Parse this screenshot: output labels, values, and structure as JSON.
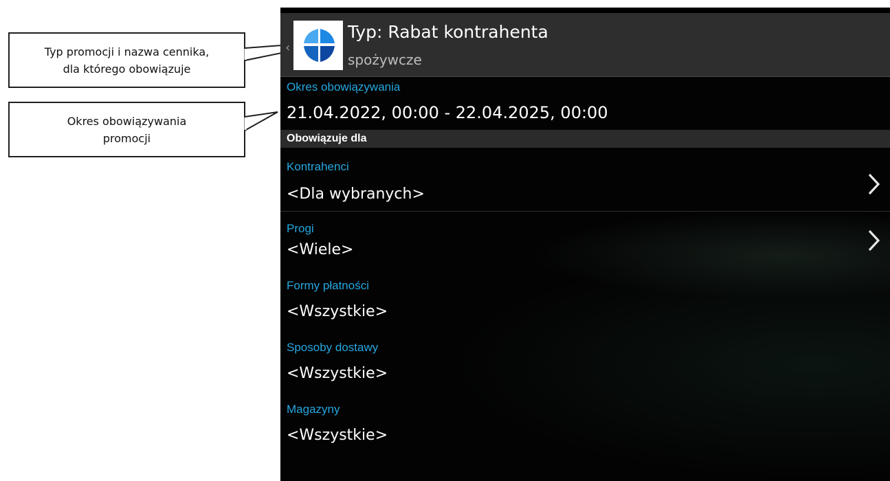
{
  "callouts": [
    {
      "line1": "Typ promocji i nazwa cennika,",
      "line2": "dla którego obowiązuje"
    },
    {
      "line1": "Okres obowiązywania",
      "line2": "promocji"
    }
  ],
  "actionbar": {
    "title": "Typ: Rabat kontrahenta",
    "subtitle": "spożywcze",
    "back_icon": "chevron-left-icon",
    "logo_icon": "app-logo-icon"
  },
  "period": {
    "label": "Okres obowiązywania",
    "value": "21.04.2022, 00:00 - 22.04.2025, 00:00"
  },
  "section": {
    "title": "Obowiązuje dla"
  },
  "fields": [
    {
      "label": "Kontrahenci",
      "value": "<Dla wybranych>",
      "has_chevron": true
    },
    {
      "label": "Progi",
      "value": "<Wiele>",
      "has_chevron": true
    },
    {
      "label": "Formy płatności",
      "value": "<Wszystkie>",
      "has_chevron": false
    },
    {
      "label": "Sposoby dostawy",
      "value": "<Wszystkie>",
      "has_chevron": false
    },
    {
      "label": "Magazyny",
      "value": "<Wszystkie>",
      "has_chevron": false
    }
  ],
  "colors": {
    "accent": "#25a7e0",
    "actionbar": "#2e2e2e",
    "background": "#030303",
    "logo_blue": "#1e88e5"
  }
}
